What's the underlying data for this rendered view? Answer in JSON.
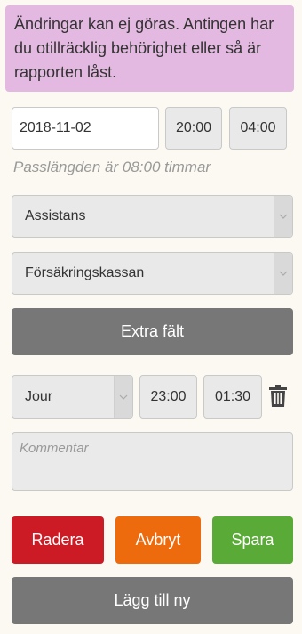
{
  "banner": {
    "message": "Ändringar kan ej göras. Antingen har du otillräcklig behörighet eller så är rapporten låst."
  },
  "shift": {
    "date": "2018-11-02",
    "start_time": "20:00",
    "end_time": "04:00",
    "duration_text": "Passlängden är 08:00 timmar"
  },
  "selects": {
    "type": "Assistans",
    "payer": "Försäkringskassan"
  },
  "buttons": {
    "extra_fields": "Extra fält",
    "delete": "Radera",
    "cancel": "Avbryt",
    "save": "Spara",
    "add_new": "Lägg till ny"
  },
  "sub_shift": {
    "kind": "Jour",
    "start_time": "23:00",
    "end_time": "01:30"
  },
  "comment": {
    "placeholder": "Kommentar"
  },
  "icons": {
    "dropdown": "chevron-down-icon",
    "trash": "trash-icon"
  },
  "colors": {
    "banner": "#e4b9e1",
    "delete": "#cc1b24",
    "cancel": "#ee6b0d",
    "save": "#5aaa37",
    "neutral": "#777777"
  }
}
